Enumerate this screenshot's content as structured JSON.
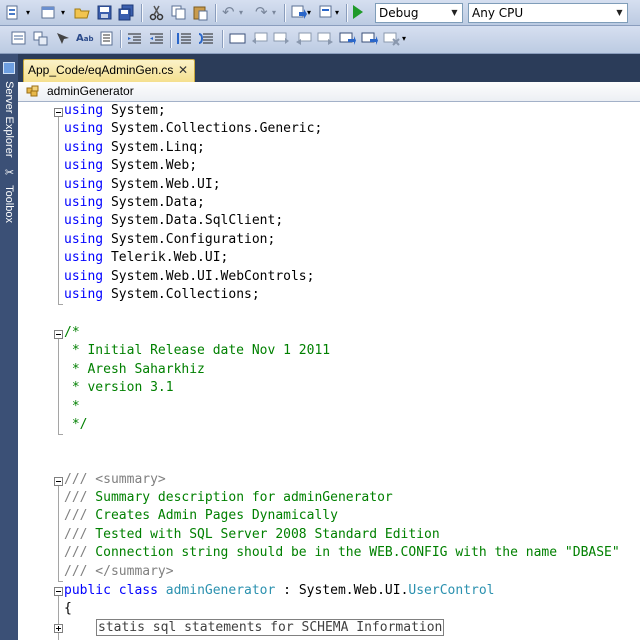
{
  "toolbar": {
    "config_value": "Debug",
    "platform_value": "Any CPU",
    "icons_row1": [
      "new-project-icon",
      "add-item-icon",
      "open-file-icon",
      "save-icon",
      "save-all-icon",
      "cut-icon",
      "copy-icon",
      "paste-icon",
      "undo-icon",
      "redo-icon",
      "navigate-backward-icon",
      "navigate-forward-icon",
      "start-debugging-icon"
    ],
    "icons_row2": [
      "properties-icon",
      "solution-explorer-icon",
      "object-browser-icon",
      "format-document-icon",
      "toolbox-icon",
      "outdent-icon",
      "indent-icon",
      "comment-icon",
      "uncomment-icon",
      "bookmark-icon",
      "prev-bookmark-icon",
      "next-bookmark-icon",
      "prev-bookmark-folder-icon",
      "next-bookmark-folder-icon",
      "clear-bookmarks-icon"
    ]
  },
  "side_tabs": {
    "server_explorer": "Server Explorer",
    "toolbox": "Toolbox"
  },
  "document_tab": {
    "title": "App_Code/eqAdminGen.cs",
    "close": "✕"
  },
  "nav_bar": {
    "class_name": "adminGenerator"
  },
  "code": {
    "usings": [
      "System;",
      "System.Collections.Generic;",
      "System.Linq;",
      "System.Web;",
      "System.Web.UI;",
      "System.Data;",
      "System.Data.SqlClient;",
      "System.Configuration;",
      "Telerik.Web.UI;",
      "System.Web.UI.WebControls;",
      "System.Collections;"
    ],
    "using_keyword": "using",
    "comment_block": [
      "/*",
      " * Initial Release date Nov 1 2011",
      " * Aresh Saharkhiz",
      " * version 3.1",
      " *",
      " */"
    ],
    "doc_prefix": "///",
    "doc_summary_open": " <summary>",
    "doc_lines": [
      " Summary description for adminGenerator",
      " Creates Admin Pages Dynamically",
      " Tested with SQL Server 2008 Standard Edition",
      " Connection string should be in the WEB.CONFIG with the name \"DBASE\""
    ],
    "doc_summary_close": " </summary>",
    "class_public": "public",
    "class_keyword": "class",
    "class_name": "adminGenerator",
    "class_sep": " : System.Web.UI.",
    "class_base": "UserControl",
    "open_brace": "{",
    "collapsed_region": "statis sql statements for SCHEMA Information"
  }
}
